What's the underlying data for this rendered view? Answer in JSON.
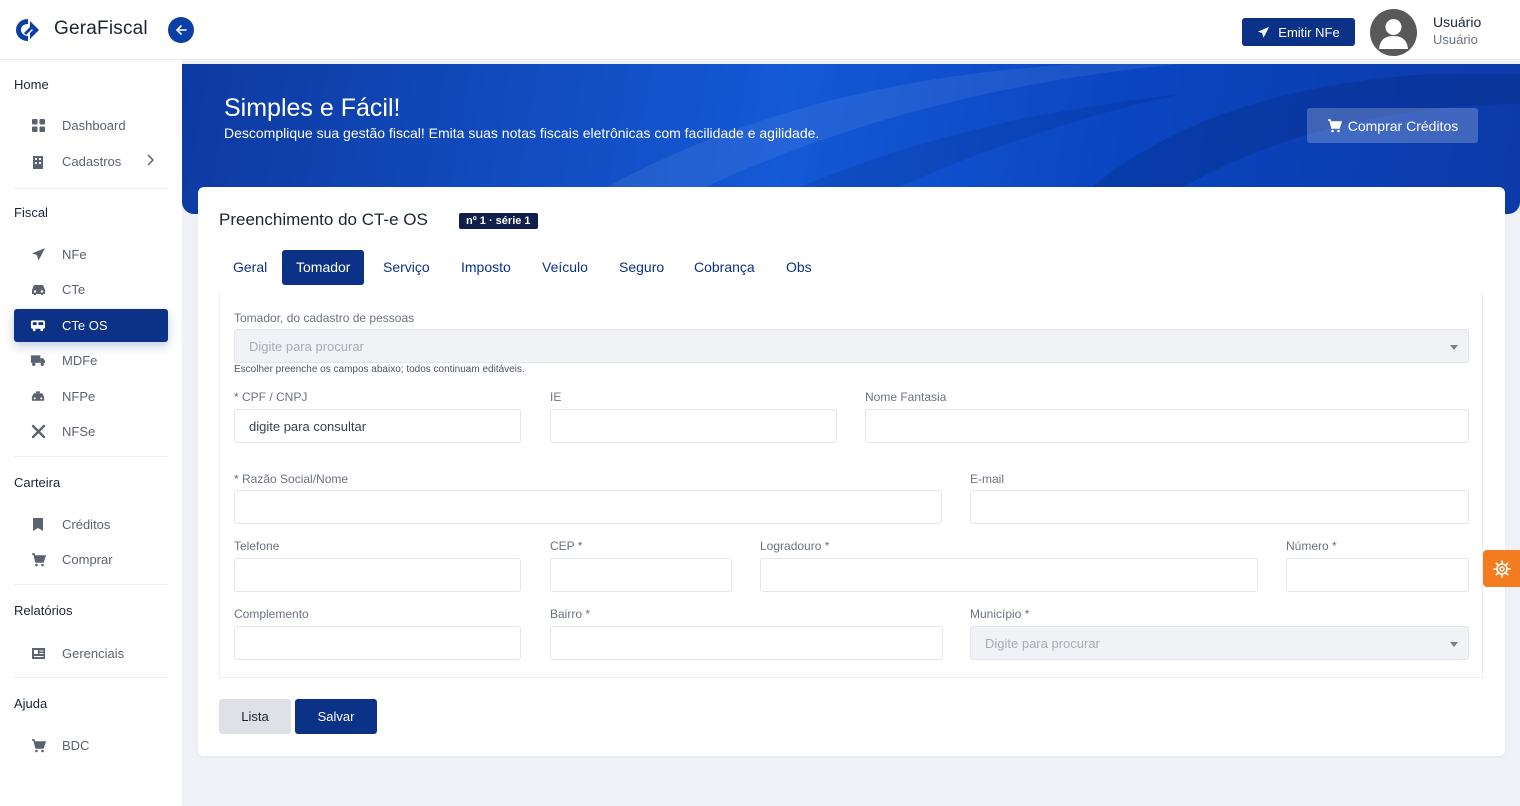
{
  "header": {
    "brand": "GeraFiscal",
    "emit_label": "Emitir NFe",
    "user_name": "Usuário",
    "user_role": "Usuário"
  },
  "sidebar": {
    "sections": [
      {
        "title": "Home",
        "items": [
          {
            "label": "Dashboard",
            "icon": "dashboard-icon"
          },
          {
            "label": "Cadastros",
            "icon": "building-icon"
          }
        ]
      },
      {
        "title": "Fiscal",
        "items": [
          {
            "label": "NFe",
            "icon": "paper-plane-icon"
          },
          {
            "label": "CTe",
            "icon": "car-icon"
          },
          {
            "label": "CTe OS",
            "icon": "bus-icon"
          },
          {
            "label": "MDFe",
            "icon": "truck-icon"
          },
          {
            "label": "NFPe",
            "icon": "taxi-icon"
          },
          {
            "label": "NFSe",
            "icon": "tools-icon"
          }
        ]
      },
      {
        "title": "Carteira",
        "items": [
          {
            "label": "Créditos",
            "icon": "bookmark-icon"
          },
          {
            "label": "Comprar",
            "icon": "cart-icon"
          }
        ]
      },
      {
        "title": "Relatórios",
        "items": [
          {
            "label": "Gerenciais",
            "icon": "report-icon"
          }
        ]
      },
      {
        "title": "Ajuda",
        "items": [
          {
            "label": "BDC",
            "icon": "cart-icon"
          }
        ]
      }
    ],
    "active_item": "CTe OS"
  },
  "hero": {
    "title": "Simples e Fácil!",
    "subtitle": "Descomplique sua gestão fiscal! Emita suas notas fiscais eletrônicas com facilidade e agilidade.",
    "buy_label": "Comprar Créditos"
  },
  "form": {
    "title": "Preenchimento do CT-e OS",
    "badge": "nº 1 · série 1",
    "tabs": [
      "Geral",
      "Tomador",
      "Serviço",
      "Imposto",
      "Veículo",
      "Seguro",
      "Cobrança",
      "Obs"
    ],
    "active_tab": "Tomador",
    "tomador_label": "Tomador, do cadastro de pessoas",
    "tomador_placeholder": "Digite para procurar",
    "tomador_help": "Escolher preenche os campos abaixo; todos continuam editáveis.",
    "cpf_label": "* CPF / CNPJ",
    "cpf_value": "digite para consultar",
    "ie_label": "IE",
    "fantasia_label": "Nome Fantasia",
    "razao_label": "* Razão Social/Nome",
    "email_label": "E-mail",
    "telefone_label": "Telefone",
    "cep_label": "CEP *",
    "logradouro_label": "Logradouro *",
    "numero_label": "Número *",
    "complemento_label": "Complemento",
    "bairro_label": "Bairro *",
    "municipio_label": "Município *",
    "municipio_placeholder": "Digite para procurar",
    "list_label": "Lista",
    "save_label": "Salvar"
  },
  "colors": {
    "primary": "#0b3287",
    "accent": "#f47c20"
  }
}
